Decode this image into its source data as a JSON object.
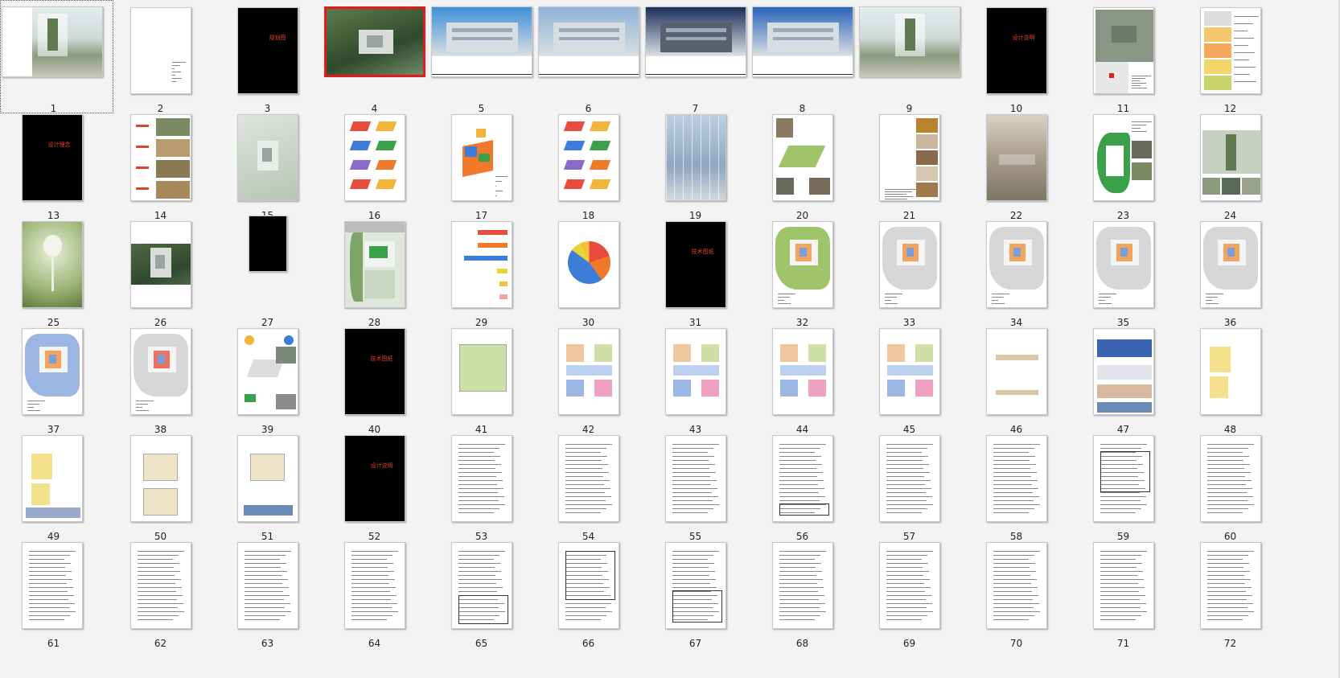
{
  "app": {
    "view": "slide-sorter",
    "selected_slide": 4,
    "focused_slide": 1
  },
  "slides": [
    {
      "n": "1",
      "kind": "photo-concourse",
      "wide": true
    },
    {
      "n": "2",
      "kind": "white-text"
    },
    {
      "n": "3",
      "kind": "black",
      "title": "规划图"
    },
    {
      "n": "4",
      "kind": "aerial",
      "wide": true,
      "active": true
    },
    {
      "n": "5",
      "kind": "building-day",
      "wide": true
    },
    {
      "n": "6",
      "kind": "building-evening",
      "wide": true
    },
    {
      "n": "7",
      "kind": "building-dusk",
      "wide": true
    },
    {
      "n": "8",
      "kind": "building-blue",
      "wide": true
    },
    {
      "n": "9",
      "kind": "photo-concourse",
      "wide": true
    },
    {
      "n": "10",
      "kind": "black",
      "title": "设计说明"
    },
    {
      "n": "11",
      "kind": "satellite"
    },
    {
      "n": "12",
      "kind": "diagram-yellow"
    },
    {
      "n": "13",
      "kind": "black",
      "title": "设计理念"
    },
    {
      "n": "14",
      "kind": "photo-list"
    },
    {
      "n": "15",
      "kind": "faded-aerial"
    },
    {
      "n": "16",
      "kind": "axon-colors"
    },
    {
      "n": "17",
      "kind": "axon-big"
    },
    {
      "n": "18",
      "kind": "axon-small"
    },
    {
      "n": "19",
      "kind": "glass-hall"
    },
    {
      "n": "20",
      "kind": "diagram-green"
    },
    {
      "n": "21",
      "kind": "photo-column"
    },
    {
      "n": "22",
      "kind": "painting"
    },
    {
      "n": "23",
      "kind": "site-green"
    },
    {
      "n": "24",
      "kind": "photo-interior"
    },
    {
      "n": "25",
      "kind": "green-cover"
    },
    {
      "n": "26",
      "kind": "aerial-small"
    },
    {
      "n": "27",
      "kind": "black-small"
    },
    {
      "n": "28",
      "kind": "site-plan"
    },
    {
      "n": "29",
      "kind": "bar-chart"
    },
    {
      "n": "30",
      "kind": "pie-chart"
    },
    {
      "n": "31",
      "kind": "black",
      "title": "技术图纸"
    },
    {
      "n": "32",
      "kind": "plan-green"
    },
    {
      "n": "33",
      "kind": "plan-gray"
    },
    {
      "n": "34",
      "kind": "plan-gray"
    },
    {
      "n": "35",
      "kind": "plan-orange"
    },
    {
      "n": "36",
      "kind": "plan-gray"
    },
    {
      "n": "37",
      "kind": "plan-blue"
    },
    {
      "n": "38",
      "kind": "plan-red"
    },
    {
      "n": "39",
      "kind": "diagram-icons"
    },
    {
      "n": "40",
      "kind": "black",
      "title": "技术图纸"
    },
    {
      "n": "41",
      "kind": "floor-green"
    },
    {
      "n": "42",
      "kind": "floor-color"
    },
    {
      "n": "43",
      "kind": "floor-color"
    },
    {
      "n": "44",
      "kind": "floor-color"
    },
    {
      "n": "45",
      "kind": "floor-color"
    },
    {
      "n": "46",
      "kind": "elev-sparse"
    },
    {
      "n": "47",
      "kind": "elevations"
    },
    {
      "n": "48",
      "kind": "section-yellow"
    },
    {
      "n": "49",
      "kind": "section-yellow2"
    },
    {
      "n": "50",
      "kind": "plan-small"
    },
    {
      "n": "51",
      "kind": "plan-elev"
    },
    {
      "n": "52",
      "kind": "black",
      "title": "设计说明"
    },
    {
      "n": "53",
      "kind": "text"
    },
    {
      "n": "54",
      "kind": "text"
    },
    {
      "n": "55",
      "kind": "text"
    },
    {
      "n": "56",
      "kind": "text-table"
    },
    {
      "n": "57",
      "kind": "text"
    },
    {
      "n": "58",
      "kind": "text"
    },
    {
      "n": "59",
      "kind": "text-table2"
    },
    {
      "n": "60",
      "kind": "text"
    },
    {
      "n": "61",
      "kind": "text"
    },
    {
      "n": "62",
      "kind": "text"
    },
    {
      "n": "63",
      "kind": "text"
    },
    {
      "n": "64",
      "kind": "text"
    },
    {
      "n": "65",
      "kind": "text-table3"
    },
    {
      "n": "66",
      "kind": "text-table4"
    },
    {
      "n": "67",
      "kind": "text-table5"
    },
    {
      "n": "68",
      "kind": "text"
    },
    {
      "n": "69",
      "kind": "text"
    },
    {
      "n": "70",
      "kind": "text"
    },
    {
      "n": "71",
      "kind": "text"
    },
    {
      "n": "72",
      "kind": "text"
    }
  ],
  "colors": {
    "selection_border": "#e21b1b",
    "background": "#f3f3f3",
    "black_slide_title": "#e0432a"
  }
}
